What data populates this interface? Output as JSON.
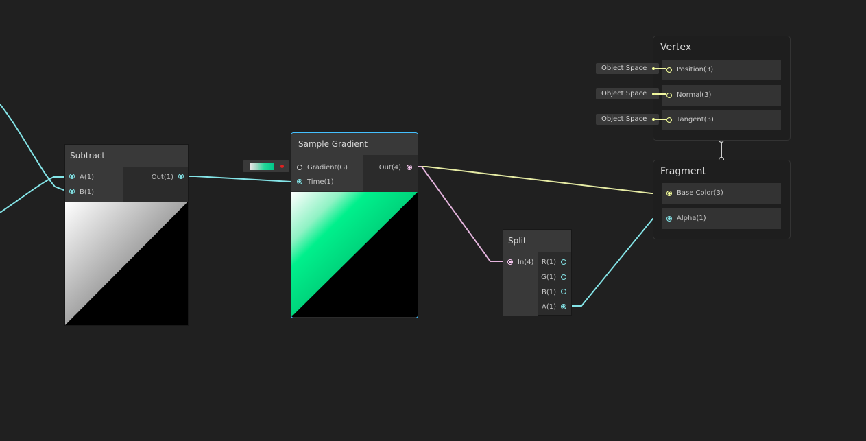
{
  "graph": {
    "subtract": {
      "title": "Subtract",
      "inputs": [
        "A(1)",
        "B(1)"
      ],
      "output": "Out(1)"
    },
    "sample_gradient": {
      "title": "Sample Gradient",
      "inputs": [
        "Gradient(G)",
        "Time(1)"
      ],
      "output": "Out(4)"
    },
    "split": {
      "title": "Split",
      "input": "In(4)",
      "outputs": [
        "R(1)",
        "G(1)",
        "B(1)",
        "A(1)"
      ]
    },
    "vertex": {
      "title": "Vertex",
      "slots": [
        "Position(3)",
        "Normal(3)",
        "Tangent(3)"
      ],
      "space_labels": [
        "Object Space",
        "Object Space",
        "Object Space"
      ]
    },
    "fragment": {
      "title": "Fragment",
      "slots": [
        "Base Color(3)",
        "Alpha(1)"
      ]
    }
  },
  "colors": {
    "canvas": "#202020",
    "float_port": "#84e4e7",
    "vector4_port": "#fbcbf4",
    "vector3_port": "#f6ff9a",
    "selection": "#44c0ff"
  }
}
